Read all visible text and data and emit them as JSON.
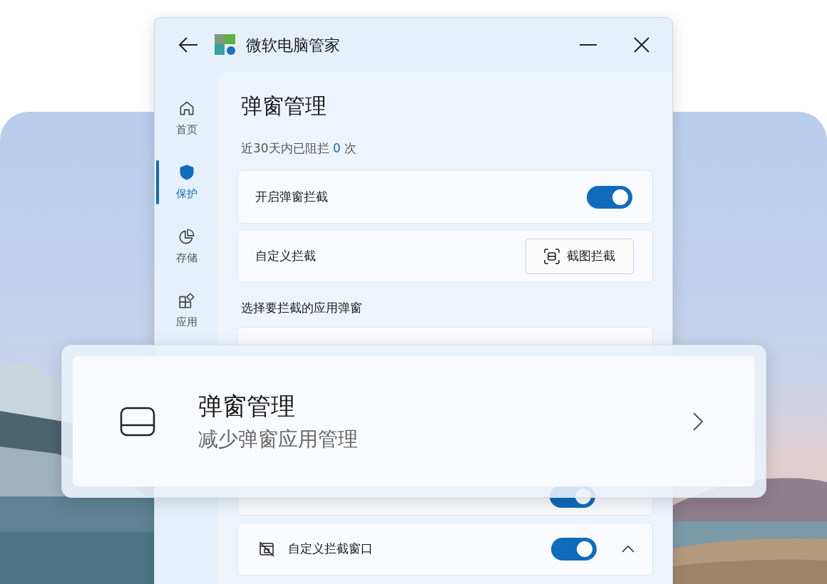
{
  "window": {
    "title": "微软电脑管家"
  },
  "sidebar": {
    "items": [
      {
        "label": "首页",
        "selected": false
      },
      {
        "label": "保护",
        "selected": true
      },
      {
        "label": "存储",
        "selected": false
      },
      {
        "label": "应用",
        "selected": false
      }
    ]
  },
  "page": {
    "title": "弹窗管理",
    "stat": {
      "prefix": "近30天内已阻拦",
      "count": "0",
      "suffix": "次"
    },
    "settings": [
      {
        "kind": "toggle",
        "label": "开启弹窗拦截",
        "on": true
      },
      {
        "kind": "button",
        "label": "自定义拦截",
        "button": "截图拦截"
      }
    ],
    "section_label": "选择要拦截的应用弹窗",
    "app_rows": [
      {
        "kind": "hidden",
        "on": true
      },
      {
        "kind": "expandable",
        "label": "自定义拦截窗口",
        "on": true,
        "expanded": true
      }
    ]
  },
  "overlay_card": {
    "title": "弹窗管理",
    "subtitle": "减少弹窗应用管理"
  }
}
